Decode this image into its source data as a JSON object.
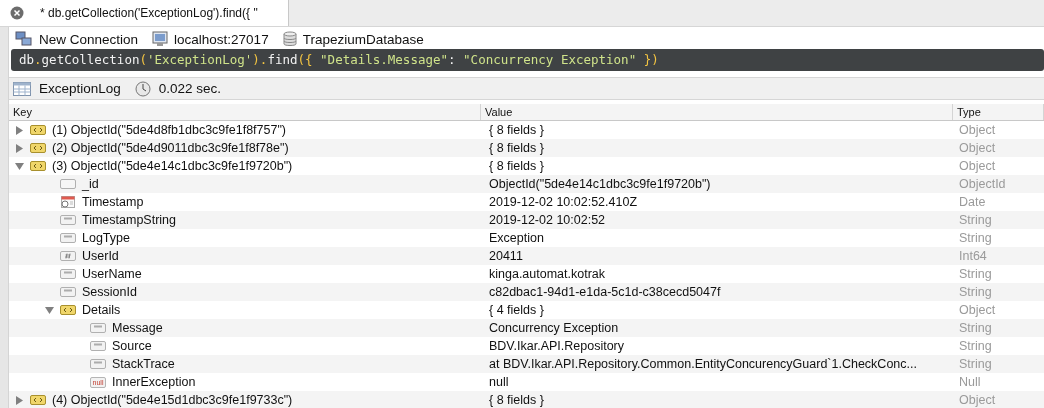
{
  "tab": {
    "title": "* db.getCollection('ExceptionLog').find({ \"",
    "selected": true
  },
  "connection": [
    {
      "kind": "connection",
      "label": "New Connection"
    },
    {
      "kind": "server",
      "label": "localhost:27017"
    },
    {
      "kind": "database",
      "label": "TrapeziumDatabase"
    }
  ],
  "query": [
    {
      "kind": "ident",
      "text": "db"
    },
    {
      "kind": "punct",
      "text": "."
    },
    {
      "kind": "ident",
      "text": "getCollection"
    },
    {
      "kind": "punct",
      "text": "("
    },
    {
      "kind": "string",
      "text": "'ExceptionLog'"
    },
    {
      "kind": "punct",
      "text": ")"
    },
    {
      "kind": "punct",
      "text": "."
    },
    {
      "kind": "ident",
      "text": "find"
    },
    {
      "kind": "punct",
      "text": "({ "
    },
    {
      "kind": "string",
      "text": "\"Details.Message\""
    },
    {
      "kind": "ident",
      "text": ": "
    },
    {
      "kind": "string",
      "text": "\"Concurrency Exception\""
    },
    {
      "kind": "punct",
      "text": " })"
    }
  ],
  "result": {
    "collection": "ExceptionLog",
    "time": "0.022 sec."
  },
  "table": {
    "columns": [
      "Key",
      "Value",
      "Type"
    ],
    "rows": [
      {
        "kind": "object",
        "key": "(1) ObjectId(\"5de4d8fb1dbc3c9fe1f8f757\")",
        "value": "{ 8 fields }",
        "type": "Object",
        "expanded": false
      },
      {
        "kind": "object",
        "key": "(2) ObjectId(\"5de4d9011dbc3c9fe1f8f78e\")",
        "value": "{ 8 fields }",
        "type": "Object",
        "expanded": false
      },
      {
        "kind": "object",
        "key": "(3) ObjectId(\"5de4e14c1dbc3c9fe1f9720b\")",
        "value": "{ 8 fields }",
        "type": "Object",
        "expanded": true,
        "children": [
          {
            "kind": "objectid",
            "key": "_id",
            "value": "ObjectId(\"5de4e14c1dbc3c9fe1f9720b\")",
            "type": "ObjectId"
          },
          {
            "kind": "date",
            "key": "Timestamp",
            "value": "2019-12-02 10:02:52.410Z",
            "type": "Date"
          },
          {
            "kind": "string",
            "key": "TimestampString",
            "value": "2019-12-02 10:02:52",
            "type": "String"
          },
          {
            "kind": "string",
            "key": "LogType",
            "value": "Exception",
            "type": "String"
          },
          {
            "kind": "int",
            "key": "UserId",
            "value": "20411",
            "type": "Int64"
          },
          {
            "kind": "string",
            "key": "UserName",
            "value": "kinga.automat.kotrak",
            "type": "String"
          },
          {
            "kind": "string",
            "key": "SessionId",
            "value": "c82dbac1-94d1-e1da-5c1d-c38cecd5047f",
            "type": "String"
          },
          {
            "kind": "object",
            "key": "Details",
            "value": "{ 4 fields }",
            "type": "Object",
            "expanded": true,
            "children": [
              {
                "kind": "string",
                "key": "Message",
                "value": "Concurrency Exception",
                "type": "String"
              },
              {
                "kind": "string",
                "key": "Source",
                "value": "BDV.Ikar.API.Repository",
                "type": "String"
              },
              {
                "kind": "string",
                "key": "StackTrace",
                "value": "at BDV.Ikar.API.Repository.Common.EntityConcurencyGuard`1.CheckConc...",
                "type": "String"
              },
              {
                "kind": "null",
                "icon_text": "null",
                "key": "InnerException",
                "value": "null",
                "type": "Null"
              }
            ]
          }
        ]
      },
      {
        "kind": "object",
        "key": "(4) ObjectId(\"5de4e15d1dbc3c9fe1f9733c\")",
        "value": "{ 8 fields }",
        "type": "Object",
        "expanded": false
      }
    ]
  }
}
